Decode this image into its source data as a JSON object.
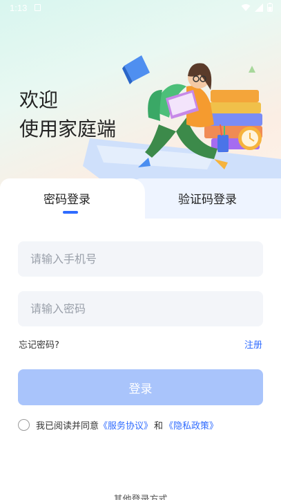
{
  "status_bar": {
    "time": "1:13"
  },
  "hero": {
    "welcome_line1": "欢迎",
    "welcome_line2": "使用家庭端"
  },
  "tabs": [
    {
      "label": "密码登录",
      "active": true
    },
    {
      "label": "验证码登录",
      "active": false
    }
  ],
  "form": {
    "phone_placeholder": "请输入手机号",
    "password_placeholder": "请输入密码",
    "forgot_label": "忘记密码?",
    "register_label": "注册",
    "login_label": "登录"
  },
  "agreement": {
    "prefix": "我已阅读并同意",
    "service_link": "《服务协议》",
    "and": "和",
    "privacy_link": "《隐私政策》",
    "checked": false
  },
  "footer": {
    "other_login": "其他登录方式"
  },
  "colors": {
    "accent": "#2f6bff",
    "button_disabled": "#a9c4fb",
    "field_bg": "#f3f5f9"
  }
}
